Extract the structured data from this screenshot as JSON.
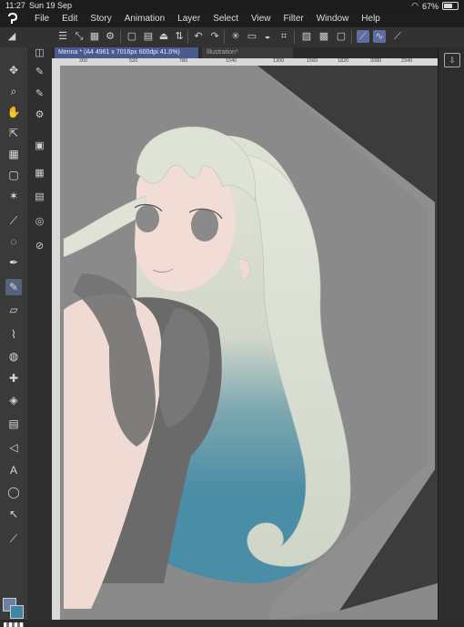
{
  "status": {
    "time": "11:27",
    "date": "Sun 19 Sep",
    "battery": "67%",
    "battery_level": 0.67
  },
  "menu": {
    "items": [
      "File",
      "Edit",
      "Story",
      "Animation",
      "Layer",
      "Select",
      "View",
      "Filter",
      "Window",
      "Help"
    ]
  },
  "tabs": [
    {
      "label": "Menna * (A4 4961 x 7016px 600dpi 41.0%)"
    },
    {
      "label": "Illustration*"
    }
  ],
  "ruler": {
    "top_labels": [
      "260",
      "520",
      "780",
      "1040",
      "1300",
      "1560",
      "1820",
      "2080",
      "2340"
    ]
  },
  "colors": {
    "main": "#6b7fa8",
    "sub": "#3f86a5",
    "hair": "#dfe3d6",
    "hair_tip": "#4a8da6",
    "skin": "#f0ddd6",
    "dress": "#6a6a6a",
    "canvas_bg": "#8a8a8a"
  },
  "toolbar": {
    "icons": [
      "menu-icon",
      "new-canvas-icon",
      "open-icon",
      "save-icon",
      "undo-icon",
      "redo-icon",
      "clear-icon",
      "fill-icon",
      "transform-icon",
      "selection-icon",
      "invert-icon",
      "snap-ruler-icon",
      "snap-grid-icon",
      "stabilizer-icon"
    ]
  }
}
